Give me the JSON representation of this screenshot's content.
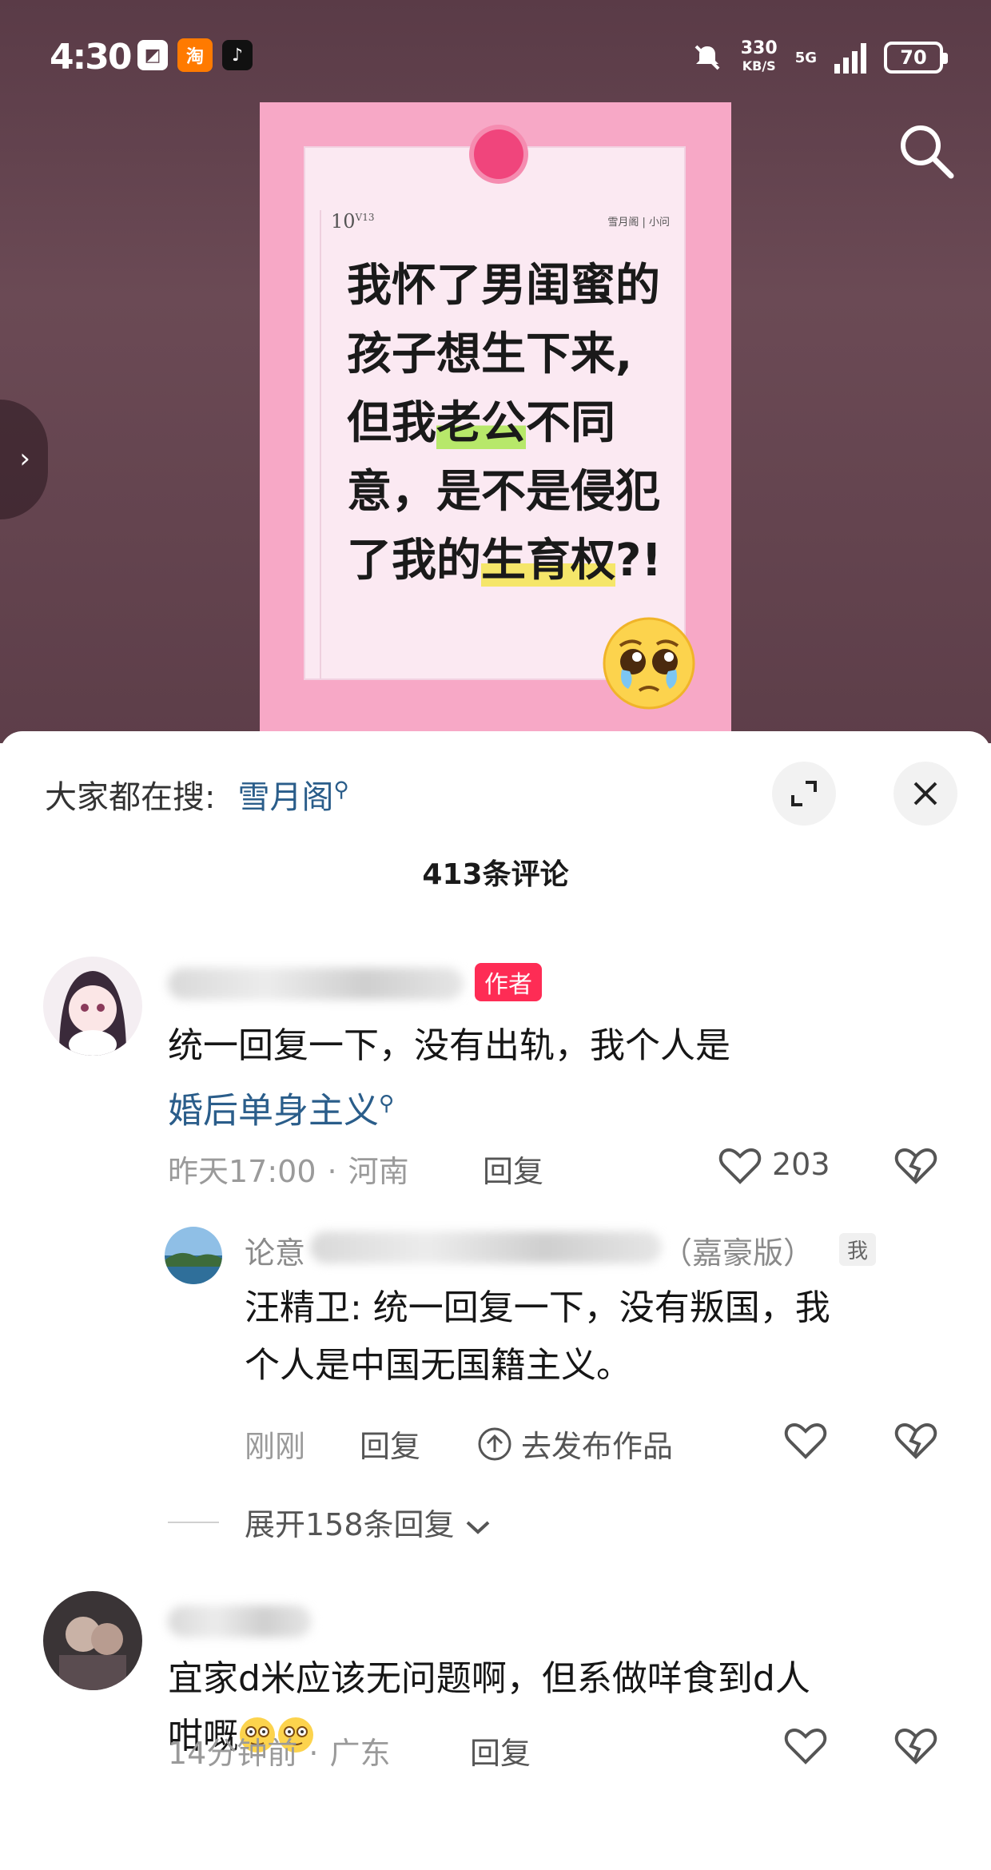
{
  "status_bar": {
    "time": "4:30",
    "app_icons": [
      "app-icon",
      "taobao-icon",
      "tiktok-icon"
    ],
    "taobao_label": "淘",
    "net_speed": "330",
    "net_speed_unit": "KB/S",
    "network": "5G",
    "battery": "70"
  },
  "post": {
    "note_number": "10",
    "note_number_suffix": "V13",
    "note_tag": "雪月阁 | 小问",
    "title_lines": [
      {
        "before": "我怀了男闺蜜的",
        "hl": "",
        "after": ""
      },
      {
        "before": "孩子想生下来,",
        "hl": "",
        "after": ""
      },
      {
        "before": "但我",
        "hl": "老公",
        "after": "不同"
      },
      {
        "before": "意，是不是侵犯",
        "hl": "",
        "after": ""
      },
      {
        "before": "了我的",
        "hl": "生育权",
        "after": "?!"
      }
    ],
    "colors": {
      "card": "#f7a8c6",
      "pin": "#f0457c",
      "green_hl": "#b7e86a",
      "yellow_hl": "#f5e66a"
    }
  },
  "sheet": {
    "hot_search_label": "大家都在搜:",
    "hot_search_keyword": "雪月阁",
    "comment_count_title": "413条评论"
  },
  "comments": [
    {
      "author_badge": "作者",
      "text_line1": "统一回复一下，没有出轨，我个人是",
      "text_link": "婚后单身主义",
      "time": "昨天17:00",
      "location": "河南",
      "reply_label": "回复",
      "likes": "203",
      "reply": {
        "name_visible_start": "论意",
        "name_visible_end": "（嘉豪版）",
        "me_badge": "我",
        "text_line1": "汪精卫: 统一回复一下，没有叛国，我",
        "text_line2": "个人是中国无国籍主义。",
        "time": "刚刚",
        "reply_label": "回复",
        "post_label": "去发布作品"
      },
      "expand_label": "展开158条回复"
    },
    {
      "text_line1": "宜家d米应该无问题啊，但系做咩食到d人",
      "text_line2": "咁嘅",
      "time": "14分钟前",
      "location": "广东",
      "reply_label": "回复"
    }
  ]
}
